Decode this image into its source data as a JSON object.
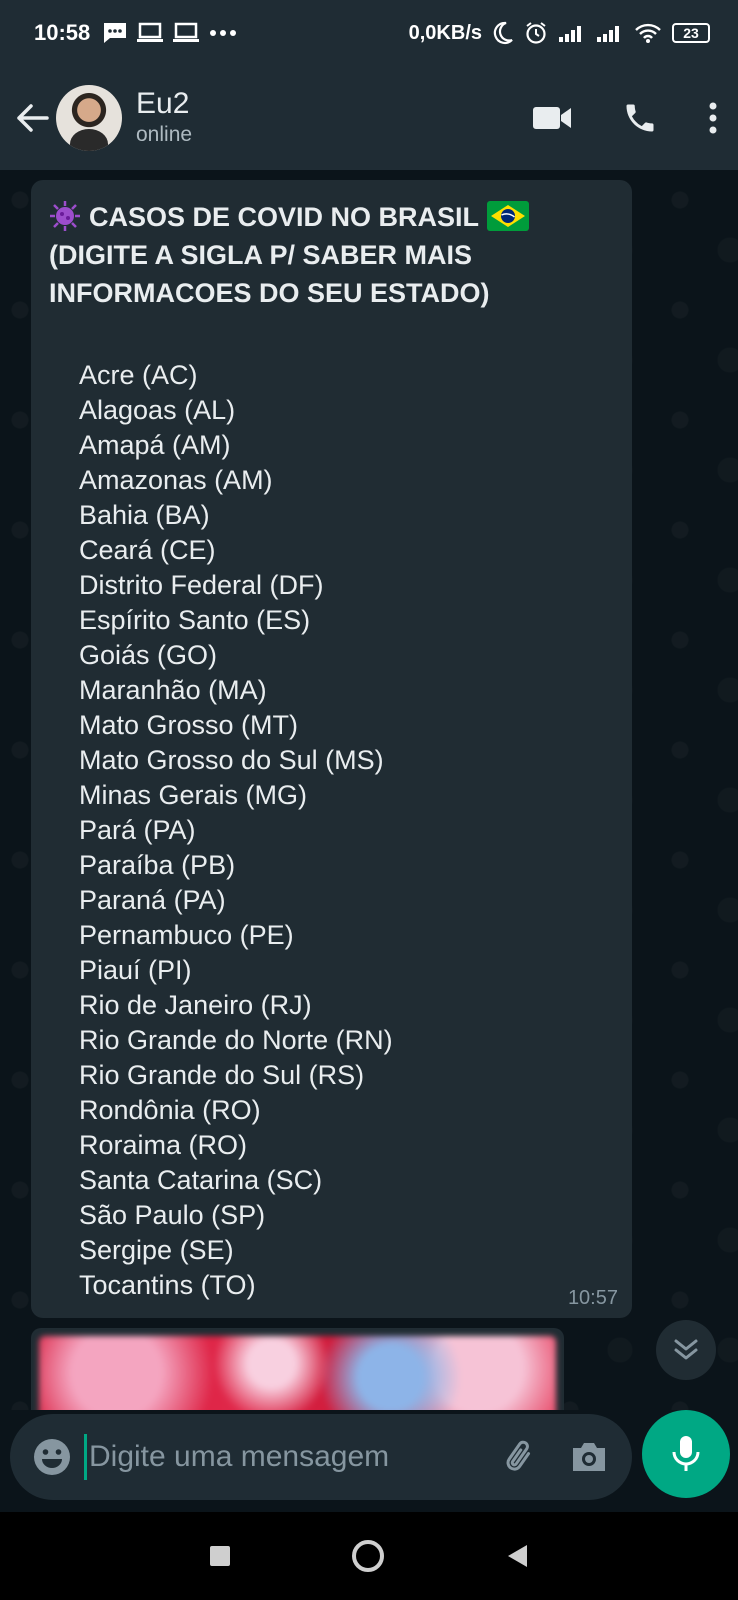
{
  "status_bar": {
    "time": "10:58",
    "left_icons": [
      "message-icon",
      "laptop-icon",
      "laptop-icon",
      "more-dots-icon"
    ],
    "net_speed": "0,0KB/s",
    "battery": "23"
  },
  "header": {
    "contact_name": "Eu2",
    "contact_status": "online"
  },
  "message": {
    "title": "CASOS DE COVID NO BRASIL",
    "subtitle": "(DIGITE A SIGLA P/ SABER MAIS INFORMACOES DO SEU ESTADO)",
    "states": [
      "Acre (AC)",
      "Alagoas (AL)",
      "Amapá (AM)",
      "Amazonas (AM)",
      "Bahia (BA)",
      "Ceará (CE)",
      "Distrito Federal (DF)",
      "Espírito Santo (ES)",
      "Goiás (GO)",
      "Maranhão (MA)",
      "Mato Grosso (MT)",
      "Mato Grosso do Sul (MS)",
      "Minas Gerais (MG)",
      "Pará (PA)",
      "Paraíba (PB)",
      "Paraná (PA)",
      "Pernambuco (PE)",
      "Piauí (PI)",
      "Rio de Janeiro (RJ)",
      "Rio Grande do Norte (RN)",
      "Rio Grande do Sul (RS)",
      "Rondônia (RO)",
      "Roraima (RO)",
      "Santa Catarina (SC)",
      "São Paulo (SP)",
      "Sergipe (SE)",
      "Tocantins (TO)"
    ],
    "time": "10:57"
  },
  "composer": {
    "placeholder": "Digite uma mensagem",
    "value": ""
  },
  "colors": {
    "accent": "#00a884",
    "bubble": "#202c33",
    "header": "#1f2c34",
    "background": "#0b141a"
  }
}
